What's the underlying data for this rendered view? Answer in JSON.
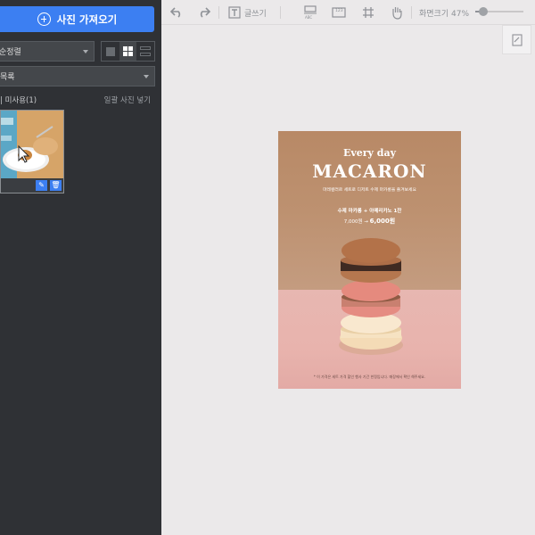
{
  "sidebar": {
    "import_button": "사진 가져오기",
    "sort_label": "순정렬",
    "folder_label": "목록",
    "unused_label": "| 미사용(1)",
    "bulk_insert": "일괄 사진 넣기"
  },
  "toolbar": {
    "text_tool": "글쓰기",
    "zoom_label": "화면크기",
    "zoom_value": "47%",
    "zoom_level": 0.1,
    "abc_label": "ABC",
    "num_label": "123"
  },
  "poster": {
    "eyebrow": "Every day",
    "title": "MACARON",
    "description": "마레컬러르 세트로 디저트 수제 마카롱을 즐겨보세요",
    "offer": "수제 마카롱 + 아메리카노 1잔",
    "price_before": "7,000원",
    "arrow": "→",
    "price_after": "6,000원",
    "footer": "* 이 가격은 세트 가격 할인 행사 기간 한정입니다. 매장에서 확인 해주세요."
  },
  "colors": {
    "accent": "#3c7ff2",
    "sidebar_bg": "#2f3135",
    "canvas_bg": "#ebe9ea"
  }
}
